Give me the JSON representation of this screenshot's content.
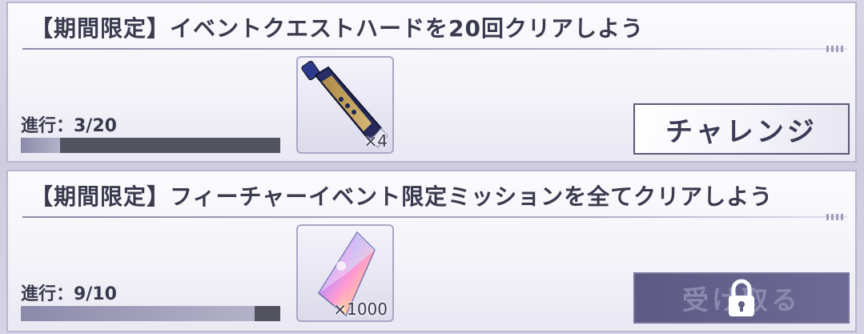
{
  "missions": [
    {
      "title": "【期間限定】イベントクエストハードを20回クリアしよう",
      "progress_label": "進行：3/20",
      "progress_fraction": 0.15,
      "reward": {
        "icon": "paint-tube-icon",
        "quantity": "×4"
      },
      "button_label": "チャレンジ"
    },
    {
      "title": "【期間限定】フィーチャーイベント限定ミッションを全てクリアしよう",
      "progress_label": "進行：9/10",
      "progress_fraction": 0.9,
      "reward": {
        "icon": "rainbow-crystal-icon",
        "quantity": "×1000"
      },
      "button_label": "受け取る",
      "locked": true
    }
  ],
  "colors": {
    "card_border": "#b9b6cf",
    "text": "#3a3a4e",
    "progress_track": "#53525f",
    "progress_fill": "#9e9cb8",
    "challenge_bg": "#ffffff",
    "receive_bg": "#605e88"
  }
}
